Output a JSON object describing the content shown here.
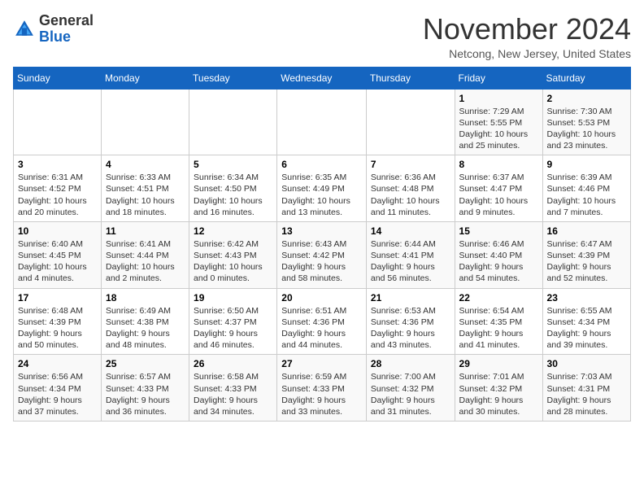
{
  "header": {
    "logo_general": "General",
    "logo_blue": "Blue",
    "month_title": "November 2024",
    "location": "Netcong, New Jersey, United States"
  },
  "weekdays": [
    "Sunday",
    "Monday",
    "Tuesday",
    "Wednesday",
    "Thursday",
    "Friday",
    "Saturday"
  ],
  "weeks": [
    [
      {
        "day": "",
        "info": ""
      },
      {
        "day": "",
        "info": ""
      },
      {
        "day": "",
        "info": ""
      },
      {
        "day": "",
        "info": ""
      },
      {
        "day": "",
        "info": ""
      },
      {
        "day": "1",
        "info": "Sunrise: 7:29 AM\nSunset: 5:55 PM\nDaylight: 10 hours and 25 minutes."
      },
      {
        "day": "2",
        "info": "Sunrise: 7:30 AM\nSunset: 5:53 PM\nDaylight: 10 hours and 23 minutes."
      }
    ],
    [
      {
        "day": "3",
        "info": "Sunrise: 6:31 AM\nSunset: 4:52 PM\nDaylight: 10 hours and 20 minutes."
      },
      {
        "day": "4",
        "info": "Sunrise: 6:33 AM\nSunset: 4:51 PM\nDaylight: 10 hours and 18 minutes."
      },
      {
        "day": "5",
        "info": "Sunrise: 6:34 AM\nSunset: 4:50 PM\nDaylight: 10 hours and 16 minutes."
      },
      {
        "day": "6",
        "info": "Sunrise: 6:35 AM\nSunset: 4:49 PM\nDaylight: 10 hours and 13 minutes."
      },
      {
        "day": "7",
        "info": "Sunrise: 6:36 AM\nSunset: 4:48 PM\nDaylight: 10 hours and 11 minutes."
      },
      {
        "day": "8",
        "info": "Sunrise: 6:37 AM\nSunset: 4:47 PM\nDaylight: 10 hours and 9 minutes."
      },
      {
        "day": "9",
        "info": "Sunrise: 6:39 AM\nSunset: 4:46 PM\nDaylight: 10 hours and 7 minutes."
      }
    ],
    [
      {
        "day": "10",
        "info": "Sunrise: 6:40 AM\nSunset: 4:45 PM\nDaylight: 10 hours and 4 minutes."
      },
      {
        "day": "11",
        "info": "Sunrise: 6:41 AM\nSunset: 4:44 PM\nDaylight: 10 hours and 2 minutes."
      },
      {
        "day": "12",
        "info": "Sunrise: 6:42 AM\nSunset: 4:43 PM\nDaylight: 10 hours and 0 minutes."
      },
      {
        "day": "13",
        "info": "Sunrise: 6:43 AM\nSunset: 4:42 PM\nDaylight: 9 hours and 58 minutes."
      },
      {
        "day": "14",
        "info": "Sunrise: 6:44 AM\nSunset: 4:41 PM\nDaylight: 9 hours and 56 minutes."
      },
      {
        "day": "15",
        "info": "Sunrise: 6:46 AM\nSunset: 4:40 PM\nDaylight: 9 hours and 54 minutes."
      },
      {
        "day": "16",
        "info": "Sunrise: 6:47 AM\nSunset: 4:39 PM\nDaylight: 9 hours and 52 minutes."
      }
    ],
    [
      {
        "day": "17",
        "info": "Sunrise: 6:48 AM\nSunset: 4:39 PM\nDaylight: 9 hours and 50 minutes."
      },
      {
        "day": "18",
        "info": "Sunrise: 6:49 AM\nSunset: 4:38 PM\nDaylight: 9 hours and 48 minutes."
      },
      {
        "day": "19",
        "info": "Sunrise: 6:50 AM\nSunset: 4:37 PM\nDaylight: 9 hours and 46 minutes."
      },
      {
        "day": "20",
        "info": "Sunrise: 6:51 AM\nSunset: 4:36 PM\nDaylight: 9 hours and 44 minutes."
      },
      {
        "day": "21",
        "info": "Sunrise: 6:53 AM\nSunset: 4:36 PM\nDaylight: 9 hours and 43 minutes."
      },
      {
        "day": "22",
        "info": "Sunrise: 6:54 AM\nSunset: 4:35 PM\nDaylight: 9 hours and 41 minutes."
      },
      {
        "day": "23",
        "info": "Sunrise: 6:55 AM\nSunset: 4:34 PM\nDaylight: 9 hours and 39 minutes."
      }
    ],
    [
      {
        "day": "24",
        "info": "Sunrise: 6:56 AM\nSunset: 4:34 PM\nDaylight: 9 hours and 37 minutes."
      },
      {
        "day": "25",
        "info": "Sunrise: 6:57 AM\nSunset: 4:33 PM\nDaylight: 9 hours and 36 minutes."
      },
      {
        "day": "26",
        "info": "Sunrise: 6:58 AM\nSunset: 4:33 PM\nDaylight: 9 hours and 34 minutes."
      },
      {
        "day": "27",
        "info": "Sunrise: 6:59 AM\nSunset: 4:33 PM\nDaylight: 9 hours and 33 minutes."
      },
      {
        "day": "28",
        "info": "Sunrise: 7:00 AM\nSunset: 4:32 PM\nDaylight: 9 hours and 31 minutes."
      },
      {
        "day": "29",
        "info": "Sunrise: 7:01 AM\nSunset: 4:32 PM\nDaylight: 9 hours and 30 minutes."
      },
      {
        "day": "30",
        "info": "Sunrise: 7:03 AM\nSunset: 4:31 PM\nDaylight: 9 hours and 28 minutes."
      }
    ]
  ]
}
